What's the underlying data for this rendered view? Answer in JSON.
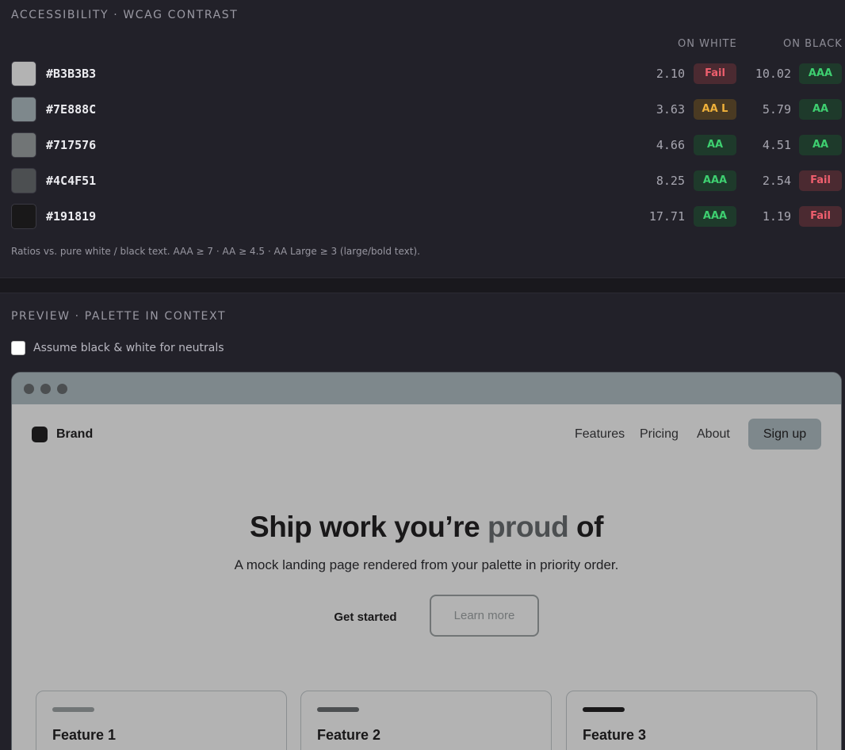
{
  "accessibility": {
    "title": "ACCESSIBILITY · WCAG CONTRAST",
    "col_on_white": "ON WHITE",
    "col_on_black": "ON BLACK",
    "rows": [
      {
        "hex": "#B3B3B3",
        "swatch": "#b3b3b3",
        "on_white": "2.10",
        "white_badge": "Fail",
        "white_status": "fail",
        "on_black": "10.02",
        "black_badge": "AAA",
        "black_status": "pass"
      },
      {
        "hex": "#7E888C",
        "swatch": "#7e888c",
        "on_white": "3.63",
        "white_badge": "AA L",
        "white_status": "aal",
        "on_black": "5.79",
        "black_badge": "AA",
        "black_status": "pass"
      },
      {
        "hex": "#717576",
        "swatch": "#717576",
        "on_white": "4.66",
        "white_badge": "AA",
        "white_status": "pass",
        "on_black": "4.51",
        "black_badge": "AA",
        "black_status": "pass"
      },
      {
        "hex": "#4C4F51",
        "swatch": "#4c4f51",
        "on_white": "8.25",
        "white_badge": "AAA",
        "white_status": "pass",
        "on_black": "2.54",
        "black_badge": "Fail",
        "black_status": "fail"
      },
      {
        "hex": "#191819",
        "swatch": "#191819",
        "on_white": "17.71",
        "white_badge": "AAA",
        "white_status": "pass",
        "on_black": "1.19",
        "black_badge": "Fail",
        "black_status": "fail"
      }
    ],
    "footnote": "Ratios vs. pure white / black text. AAA ≥ 7 · AA ≥ 4.5 · AA Large ≥ 3 (large/bold text)."
  },
  "preview": {
    "title": "PREVIEW · PALETTE IN CONTEXT",
    "checkbox_label": "Assume black & white for neutrals",
    "checkbox_checked": false,
    "mock": {
      "brand": "Brand",
      "nav": [
        "Features",
        "Pricing",
        "About"
      ],
      "signup": "Sign up",
      "hero_title_start": "Ship work you’re ",
      "hero_title_accent": "proud",
      "hero_title_end": " of",
      "hero_subtitle": "A mock landing page rendered from your palette in priority order.",
      "primary_cta": "Get started",
      "secondary_cta": "Learn more",
      "features": [
        {
          "title": "Feature 1",
          "bar_color": "#717576"
        },
        {
          "title": "Feature 2",
          "bar_color": "#4c4f51"
        },
        {
          "title": "Feature 3",
          "bar_color": "#191819"
        }
      ]
    }
  }
}
